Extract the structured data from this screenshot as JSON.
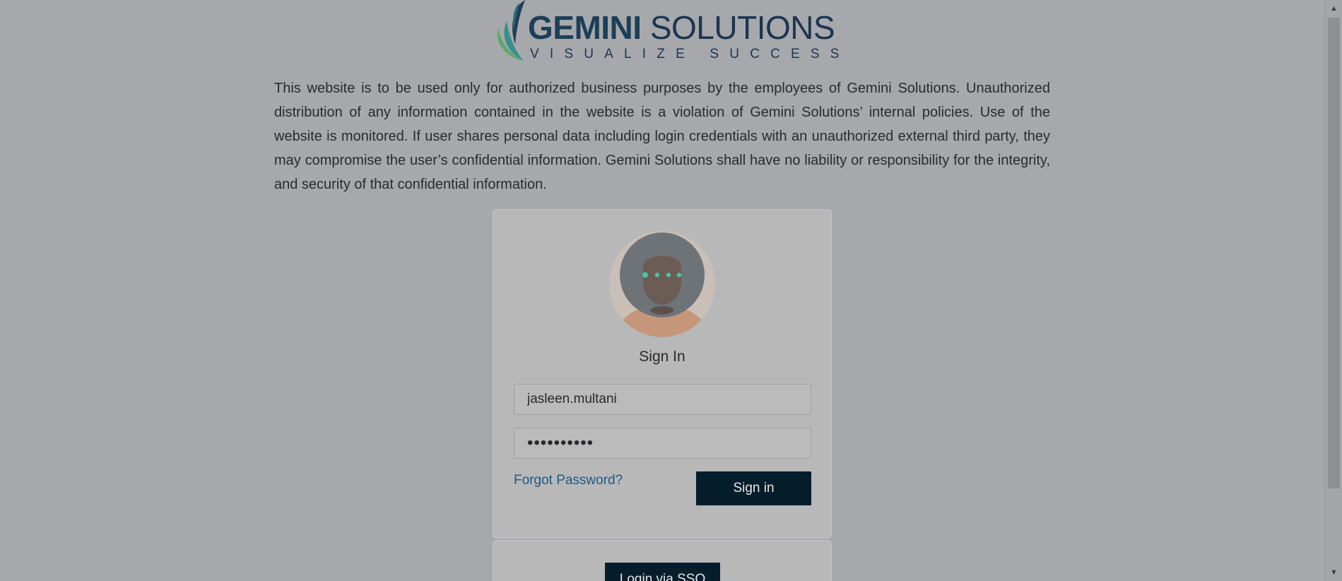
{
  "branding": {
    "name_bold": "GEMINI",
    "name_light": "SOLUTIONS",
    "tagline": "VISUALIZE SUCCESS",
    "colors": {
      "navy": "#1c3f57",
      "leaf_teal": "#3a8f8a",
      "leaf_green": "#5aa96a"
    }
  },
  "disclaimer": {
    "text": "This website is to be used only for authorized business purposes by the employees of Gemini Solutions. Unauthorized distribution of any information contained in the website is a violation of Gemini Solutions’ internal policies. Use of the website is monitored. If user shares personal data including login credentials with an unauthorized external third party, they may compromise the user’s confidential information. Gemini Solutions shall have no liability or responsibility for the integrity, and security of that confidential information."
  },
  "login": {
    "avatar_icon": "user-avatar-icon",
    "title": "Sign In",
    "username_value": "jasleen.multani",
    "password_value": "••••••••••",
    "forgot_label": "Forgot Password?",
    "signin_label": "Sign in"
  },
  "sso": {
    "label": "Login via SSO"
  },
  "colors": {
    "page_bg": "#a7a8ac",
    "button_bg": "#061d2c",
    "link": "#1f5a82"
  }
}
